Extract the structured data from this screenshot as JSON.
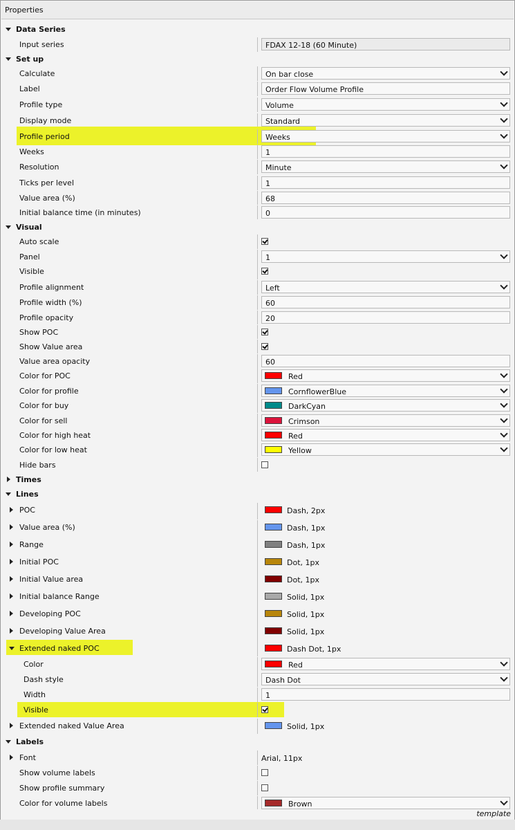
{
  "window": {
    "title": "Properties",
    "footer": "template"
  },
  "rows": [
    {
      "kind": "cat",
      "label": "Data Series",
      "expanded": true
    },
    {
      "kind": "prop",
      "label": "Input series",
      "value": "FDAX 12-18 (60 Minute)",
      "control": "readonly"
    },
    {
      "kind": "cat",
      "label": "Set up",
      "expanded": true
    },
    {
      "kind": "prop",
      "label": "Calculate",
      "value": "On bar close",
      "control": "dropdown"
    },
    {
      "kind": "prop",
      "label": "Label",
      "value": "Order Flow Volume Profile",
      "control": "text"
    },
    {
      "kind": "prop",
      "label": "Profile type",
      "value": "Volume",
      "control": "dropdown"
    },
    {
      "kind": "prop",
      "label": "Display mode",
      "value": "Standard",
      "control": "dropdown"
    },
    {
      "kind": "prop",
      "label": "Profile period",
      "value": "Weeks",
      "control": "dropdown",
      "highlight": true
    },
    {
      "kind": "prop",
      "label": "Weeks",
      "value": "1",
      "control": "text"
    },
    {
      "kind": "prop",
      "label": "Resolution",
      "value": "Minute",
      "control": "dropdown"
    },
    {
      "kind": "prop",
      "label": "Ticks per level",
      "value": "1",
      "control": "text"
    },
    {
      "kind": "prop",
      "label": "Value area (%)",
      "value": "68",
      "control": "text"
    },
    {
      "kind": "prop",
      "label": "Initial balance time (in minutes)",
      "value": "0",
      "control": "text"
    },
    {
      "kind": "cat",
      "label": "Visual",
      "expanded": true
    },
    {
      "kind": "prop",
      "label": "Auto scale",
      "checked": true,
      "control": "checkbox"
    },
    {
      "kind": "prop",
      "label": "Panel",
      "value": "1",
      "control": "dropdown"
    },
    {
      "kind": "prop",
      "label": "Visible",
      "checked": true,
      "control": "checkbox"
    },
    {
      "kind": "prop",
      "label": "Profile alignment",
      "value": "Left",
      "control": "dropdown"
    },
    {
      "kind": "prop",
      "label": "Profile width (%)",
      "value": "60",
      "control": "text"
    },
    {
      "kind": "prop",
      "label": "Profile opacity",
      "value": "20",
      "control": "text"
    },
    {
      "kind": "prop",
      "label": "Show POC",
      "checked": true,
      "control": "checkbox"
    },
    {
      "kind": "prop",
      "label": "Show Value area",
      "checked": true,
      "control": "checkbox"
    },
    {
      "kind": "prop",
      "label": "Value area opacity",
      "value": "60",
      "control": "text"
    },
    {
      "kind": "prop",
      "label": "Color for POC",
      "value": "Red",
      "color": "#ff0000",
      "control": "color"
    },
    {
      "kind": "prop",
      "label": "Color for profile",
      "value": "CornflowerBlue",
      "color": "#6495ed",
      "control": "color"
    },
    {
      "kind": "prop",
      "label": "Color for buy",
      "value": "DarkCyan",
      "color": "#008b8b",
      "control": "color"
    },
    {
      "kind": "prop",
      "label": "Color for sell",
      "value": "Crimson",
      "color": "#dc143c",
      "control": "color"
    },
    {
      "kind": "prop",
      "label": "Color for high heat",
      "value": "Red",
      "color": "#ff0000",
      "control": "color"
    },
    {
      "kind": "prop",
      "label": "Color for low heat",
      "value": "Yellow",
      "color": "#ffff00",
      "control": "color"
    },
    {
      "kind": "prop",
      "label": "Hide bars",
      "checked": false,
      "control": "checkbox"
    },
    {
      "kind": "cat",
      "label": "Times",
      "expanded": false
    },
    {
      "kind": "cat",
      "label": "Lines",
      "expanded": true
    },
    {
      "kind": "line",
      "label": "POC",
      "value": "Dash, 2px",
      "color": "#ff0000"
    },
    {
      "kind": "line",
      "label": "Value area (%)",
      "value": "Dash, 1px",
      "color": "#6495ed"
    },
    {
      "kind": "line",
      "label": "Range",
      "value": "Dash, 1px",
      "color": "#808080"
    },
    {
      "kind": "line",
      "label": "Initial POC",
      "value": "Dot, 1px",
      "color": "#b8860b"
    },
    {
      "kind": "line",
      "label": "Initial Value area",
      "value": "Dot, 1px",
      "color": "#800000"
    },
    {
      "kind": "line",
      "label": "Initial balance Range",
      "value": "Solid, 1px",
      "color": "#a9a9a9"
    },
    {
      "kind": "line",
      "label": "Developing POC",
      "value": "Solid, 1px",
      "color": "#b8860b"
    },
    {
      "kind": "line",
      "label": "Developing Value Area",
      "value": "Solid, 1px",
      "color": "#800000"
    },
    {
      "kind": "line",
      "label": "Extended naked POC",
      "value": "Dash Dot, 1px",
      "color": "#ff0000",
      "expanded": true,
      "highlight": true
    },
    {
      "kind": "sub",
      "label": "Color",
      "value": "Red",
      "color": "#ff0000",
      "control": "color"
    },
    {
      "kind": "sub",
      "label": "Dash style",
      "value": "Dash Dot",
      "control": "dropdown"
    },
    {
      "kind": "sub",
      "label": "Width",
      "value": "1",
      "control": "text"
    },
    {
      "kind": "sub",
      "label": "Visible",
      "checked": true,
      "control": "checkbox",
      "highlight": true
    },
    {
      "kind": "line",
      "label": "Extended naked Value Area",
      "value": "Solid, 1px",
      "color": "#6495ed"
    },
    {
      "kind": "cat",
      "label": "Labels",
      "expanded": true
    },
    {
      "kind": "line",
      "label": "Font",
      "value": "Arial, 11px",
      "nocolor": true
    },
    {
      "kind": "prop",
      "label": "Show volume labels",
      "checked": false,
      "control": "checkbox"
    },
    {
      "kind": "prop",
      "label": "Show profile summary",
      "checked": false,
      "control": "checkbox"
    },
    {
      "kind": "prop",
      "label": "Color for volume labels",
      "value": "Brown",
      "color": "#a52a2a",
      "control": "color"
    }
  ],
  "accent": {
    "highlight": "#ecf22a",
    "border": "#b9b9b9"
  }
}
